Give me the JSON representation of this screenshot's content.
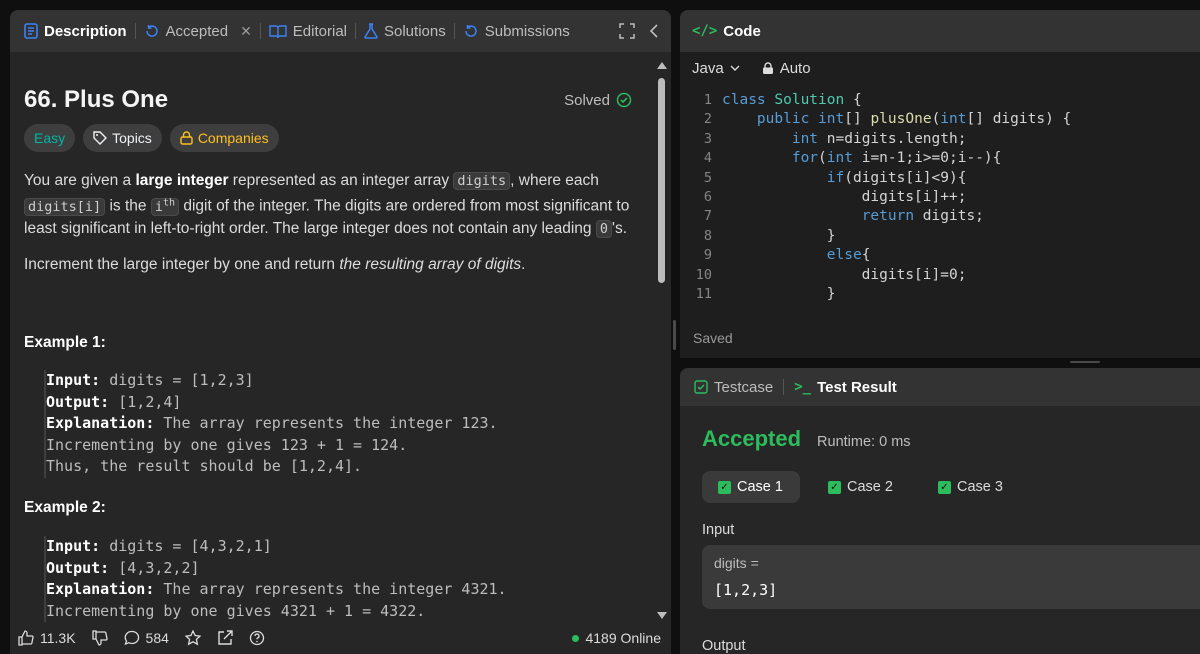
{
  "tabs": [
    {
      "label": "Description",
      "icon": "description-icon"
    },
    {
      "label": "Accepted",
      "icon": "accepted-icon"
    },
    {
      "label": "Editorial",
      "icon": "editorial-icon"
    },
    {
      "label": "Solutions",
      "icon": "solutions-icon"
    },
    {
      "label": "Submissions",
      "icon": "submissions-icon"
    }
  ],
  "problem": {
    "title": "66. Plus One",
    "solved_label": "Solved",
    "difficulty": "Easy",
    "topics_label": "Topics",
    "companies_label": "Companies",
    "desc": {
      "p1a": "You are given a ",
      "p1b": "large integer",
      "p1c": " represented as an integer array ",
      "p1code1": "digits",
      "p1d": ", where each ",
      "p1code2": "digits[i]",
      "p1e": " is the ",
      "p1code3": "i",
      "p1sup": "th",
      "p1f": " digit of the integer. The digits are ordered from most significant to least significant in left-to-right order. The large integer does not contain any leading ",
      "p1code4": "0",
      "p1g": "'s.",
      "p2a": "Increment the large integer by one and return ",
      "p2b": "the resulting array of digits",
      "p2c": "."
    },
    "examples": [
      {
        "title": "Example 1:",
        "input_label": "Input:",
        "input": " digits = [1,2,3]",
        "output_label": "Output:",
        "output": " [1,2,4]",
        "explanation_label": "Explanation:",
        "explanation_lines": [
          " The array represents the integer 123.",
          "Incrementing by one gives 123 + 1 = 124.",
          "Thus, the result should be [1,2,4]."
        ]
      },
      {
        "title": "Example 2:",
        "input_label": "Input:",
        "input": " digits = [4,3,2,1]",
        "output_label": "Output:",
        "output": " [4,3,2,2]",
        "explanation_label": "Explanation:",
        "explanation_lines": [
          " The array represents the integer 4321.",
          "Incrementing by one gives 4321 + 1 = 4322."
        ]
      }
    ]
  },
  "footer": {
    "likes": "11.3K",
    "comments": "584",
    "online": "4189 Online"
  },
  "code": {
    "header": "Code",
    "language": "Java",
    "mode": "Auto",
    "saved": "Saved",
    "line_numbers": [
      "1",
      "2",
      "3",
      "4",
      "5",
      "6",
      "7",
      "8",
      "9",
      "10",
      "11"
    ]
  },
  "test": {
    "tab_testcase": "Testcase",
    "tab_result": "Test Result",
    "status": "Accepted",
    "runtime": "Runtime: 0 ms",
    "cases": [
      "Case 1",
      "Case 2",
      "Case 3"
    ],
    "input_label": "Input",
    "var_label": "digits =",
    "var_value": "[1,2,3]",
    "output_label": "Output"
  },
  "colors": {
    "accent_green": "#2cbb5d",
    "easy": "#00b8a3",
    "companies": "#ffc01e"
  }
}
